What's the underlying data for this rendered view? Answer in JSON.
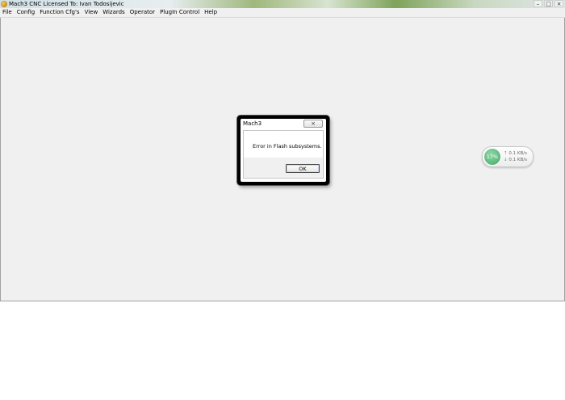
{
  "window": {
    "title": "Mach3 CNC  Licensed To: Ivan Todosijevic",
    "controls": {
      "minimize": "–",
      "maximize": "□",
      "close": "×"
    }
  },
  "menu": {
    "items": [
      "File",
      "Config",
      "Function Cfg's",
      "View",
      "Wizards",
      "Operator",
      "PlugIn Control",
      "Help"
    ]
  },
  "dialog": {
    "title": "Mach3",
    "close_symbol": "×",
    "message": "Error in Flash subsystems.",
    "ok_label": "OK"
  },
  "network_widget": {
    "percent": "17%",
    "upload": "0.1 KB/s",
    "download": "0.1 KB/s",
    "up_arrow": "↑",
    "down_arrow": "↓"
  },
  "colors": {
    "workspace_bg": "#f0f0f0",
    "widget_green": "#43a86a"
  },
  "icons": {
    "app": "mach3-app-icon",
    "close": "close-icon",
    "upload": "upload-arrow-icon",
    "download": "download-arrow-icon"
  }
}
